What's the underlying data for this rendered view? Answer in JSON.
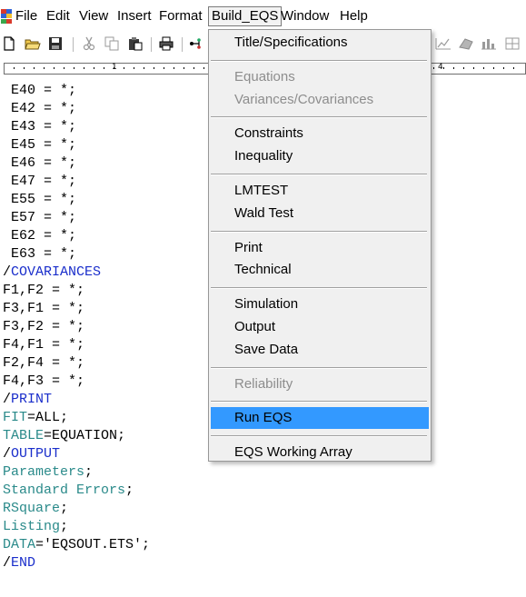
{
  "menubar": {
    "items": [
      {
        "label": "File"
      },
      {
        "label": "Edit"
      },
      {
        "label": "View"
      },
      {
        "label": "Insert"
      },
      {
        "label": "Format"
      },
      {
        "label": "Build_EQS"
      },
      {
        "label": "Window"
      },
      {
        "label": "Help"
      }
    ],
    "active": "Build_EQS"
  },
  "toolbar": {
    "buttons": [
      "new-file-icon",
      "open-folder-icon",
      "save-icon",
      "cut-icon",
      "copy-icon",
      "paste-icon",
      "print-icon",
      "diagram-icon",
      "chart-icon",
      "3d-chart-icon",
      "bar-chart-icon",
      "grid-icon"
    ]
  },
  "ruler": {
    "numbers": [
      "1",
      "4"
    ]
  },
  "editor": {
    "lines": [
      {
        "parts": [
          {
            "text": " E40 = *;",
            "color": "black"
          }
        ]
      },
      {
        "parts": [
          {
            "text": " E42 = *;",
            "color": "black"
          }
        ]
      },
      {
        "parts": [
          {
            "text": " E43 = *;",
            "color": "black"
          }
        ]
      },
      {
        "parts": [
          {
            "text": " E45 = *;",
            "color": "black"
          }
        ]
      },
      {
        "parts": [
          {
            "text": " E46 = *;",
            "color": "black"
          }
        ]
      },
      {
        "parts": [
          {
            "text": " E47 = *;",
            "color": "black"
          }
        ]
      },
      {
        "parts": [
          {
            "text": " E55 = *;",
            "color": "black"
          }
        ]
      },
      {
        "parts": [
          {
            "text": " E57 = *;",
            "color": "black"
          }
        ]
      },
      {
        "parts": [
          {
            "text": " E62 = *;",
            "color": "black"
          }
        ]
      },
      {
        "parts": [
          {
            "text": " E63 = *;",
            "color": "black"
          }
        ]
      },
      {
        "parts": [
          {
            "text": "/",
            "color": "black"
          },
          {
            "text": "COVARIANCES",
            "color": "blue"
          }
        ]
      },
      {
        "parts": [
          {
            "text": "F1,F2 = *;",
            "color": "black"
          }
        ]
      },
      {
        "parts": [
          {
            "text": "F3,F1 = *;",
            "color": "black"
          }
        ]
      },
      {
        "parts": [
          {
            "text": "F3,F2 = *;",
            "color": "black"
          }
        ]
      },
      {
        "parts": [
          {
            "text": "F4,F1 = *;",
            "color": "black"
          }
        ]
      },
      {
        "parts": [
          {
            "text": "F2,F4 = *;",
            "color": "black"
          }
        ]
      },
      {
        "parts": [
          {
            "text": "F4,F3 = *;",
            "color": "black"
          }
        ]
      },
      {
        "parts": [
          {
            "text": "/",
            "color": "black"
          },
          {
            "text": "PRINT",
            "color": "blue"
          }
        ]
      },
      {
        "parts": [
          {
            "text": "FIT",
            "color": "teal"
          },
          {
            "text": "=ALL;",
            "color": "black"
          }
        ]
      },
      {
        "parts": [
          {
            "text": "TABLE",
            "color": "teal"
          },
          {
            "text": "=EQUATION;",
            "color": "black"
          }
        ]
      },
      {
        "parts": [
          {
            "text": "/",
            "color": "black"
          },
          {
            "text": "OUTPUT",
            "color": "blue"
          }
        ]
      },
      {
        "parts": [
          {
            "text": "Parameters",
            "color": "teal"
          },
          {
            "text": ";",
            "color": "black"
          }
        ]
      },
      {
        "parts": [
          {
            "text": "Standard Errors",
            "color": "teal"
          },
          {
            "text": ";",
            "color": "black"
          }
        ]
      },
      {
        "parts": [
          {
            "text": "RSquare",
            "color": "teal"
          },
          {
            "text": ";",
            "color": "black"
          }
        ]
      },
      {
        "parts": [
          {
            "text": "Listing",
            "color": "teal"
          },
          {
            "text": ";",
            "color": "black"
          }
        ]
      },
      {
        "parts": [
          {
            "text": "DATA",
            "color": "teal"
          },
          {
            "text": "='EQSOUT.ETS';",
            "color": "black"
          }
        ]
      },
      {
        "parts": [
          {
            "text": "/",
            "color": "black"
          },
          {
            "text": "END",
            "color": "blue"
          }
        ]
      }
    ]
  },
  "dropdown": {
    "items": [
      {
        "label": "Title/Specifications",
        "enabled": true,
        "highlighted": false
      },
      {
        "separator": true
      },
      {
        "label": "Equations",
        "enabled": false,
        "highlighted": false
      },
      {
        "label": "Variances/Covariances",
        "enabled": false,
        "highlighted": false
      },
      {
        "separator": true
      },
      {
        "label": "Constraints",
        "enabled": true,
        "highlighted": false
      },
      {
        "label": "Inequality",
        "enabled": true,
        "highlighted": false
      },
      {
        "separator": true
      },
      {
        "label": "LMTEST",
        "enabled": true,
        "highlighted": false
      },
      {
        "label": "Wald Test",
        "enabled": true,
        "highlighted": false
      },
      {
        "separator": true
      },
      {
        "label": "Print",
        "enabled": true,
        "highlighted": false
      },
      {
        "label": "Technical",
        "enabled": true,
        "highlighted": false
      },
      {
        "separator": true
      },
      {
        "label": "Simulation",
        "enabled": true,
        "highlighted": false
      },
      {
        "label": "Output",
        "enabled": true,
        "highlighted": false
      },
      {
        "label": "Save Data",
        "enabled": true,
        "highlighted": false
      },
      {
        "separator": true
      },
      {
        "label": "Reliability",
        "enabled": false,
        "highlighted": false
      },
      {
        "separator": true
      },
      {
        "label": "Run EQS",
        "enabled": true,
        "highlighted": true
      },
      {
        "separator": true
      },
      {
        "label": "EQS Working Array",
        "enabled": true,
        "highlighted": false
      }
    ]
  },
  "colors": {
    "keyword_blue": "#1a2ecb",
    "keyword_teal": "#2a8a8a",
    "highlight": "#3399ff",
    "disabled": "#8d8d8d"
  }
}
